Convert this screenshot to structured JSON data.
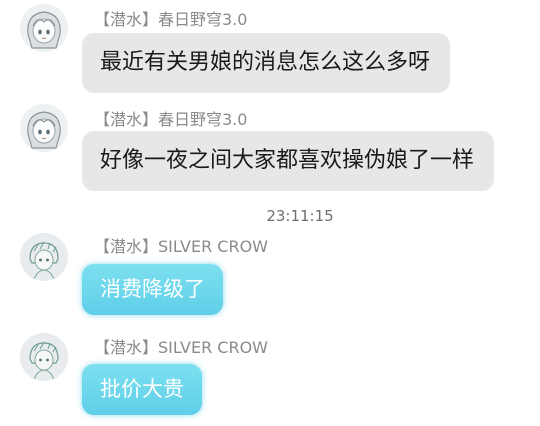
{
  "messages": [
    {
      "sender": "【潜水】春日野穹3.0",
      "text": "最近有关男娘的消息怎么这么多呀",
      "avatar_icon": "anime-girl-avatar-icon",
      "bubble_color": "#e7e7e9"
    },
    {
      "sender": "【潜水】春日野穹3.0",
      "text": "好像一夜之间大家都喜欢操伪娘了一样",
      "avatar_icon": "anime-girl-avatar-icon",
      "bubble_color": "#e7e7e9"
    },
    {
      "sender": "【潜水】SILVER CROW",
      "text": "消费降级了",
      "avatar_icon": "sketch-character-avatar-icon",
      "bubble_color": "#65d3ea"
    },
    {
      "sender": "【潜水】SILVER CROW",
      "text": "批价大贵",
      "avatar_icon": "sketch-character-avatar-icon",
      "bubble_color": "#65d3ea"
    }
  ],
  "timestamp": "23:11:15"
}
